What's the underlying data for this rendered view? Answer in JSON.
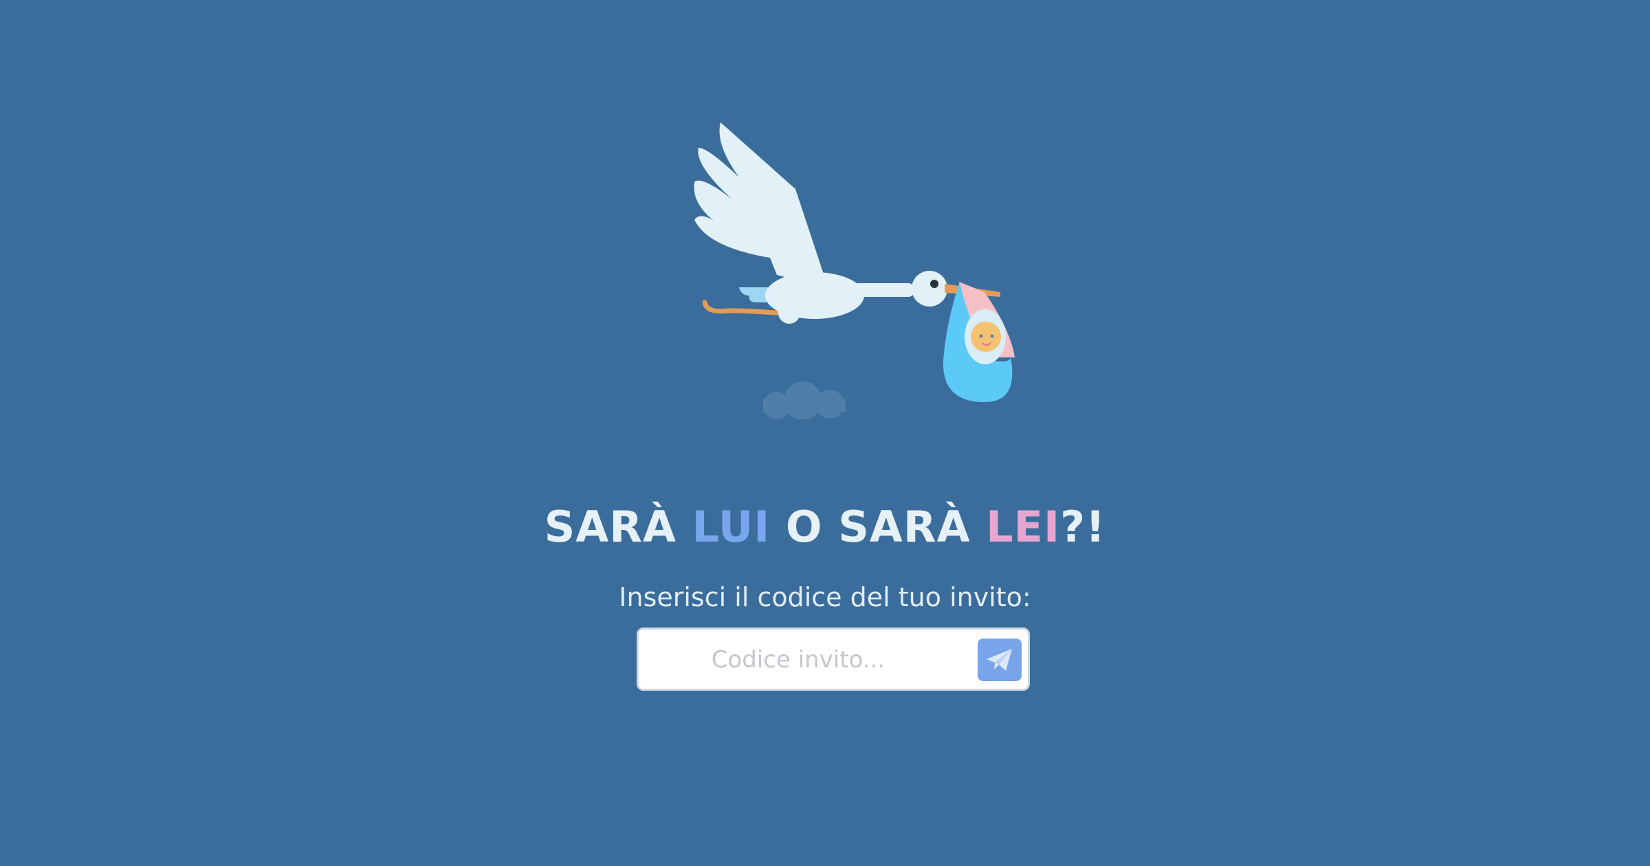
{
  "headline": {
    "part1": "SARÀ ",
    "lui": "LUI",
    "part2": " O SARÀ ",
    "lei": "LEI",
    "part3": "?!"
  },
  "subtitle": "Inserisci il codice del tuo invito:",
  "invite": {
    "placeholder": "Codice invito...",
    "value": ""
  },
  "icons": {
    "send": "paper-plane-icon",
    "illustration": "stork-with-baby-illustration"
  },
  "colors": {
    "background": "#3b6d9c",
    "lui": "#7aa6ee",
    "lei": "#e7a6d2",
    "send_button": "#78a4ea"
  }
}
